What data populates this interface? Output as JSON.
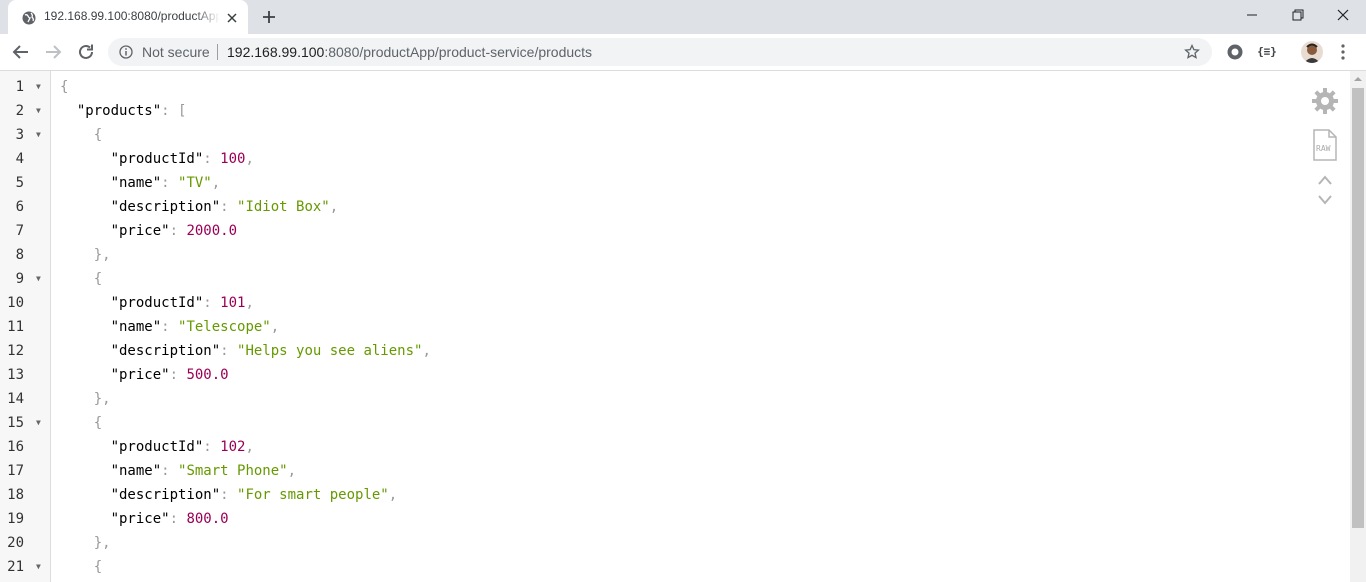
{
  "tab": {
    "title": "192.168.99.100:8080/productApp/product-service/products",
    "favicon": "globe-icon"
  },
  "toolbar": {
    "security_label": "Not secure",
    "url_host": "192.168.99.100",
    "url_rest": ":8080/productApp/product-service/products",
    "extension2_label": "{≡}"
  },
  "json_lines": [
    {
      "n": "1",
      "fold": true,
      "parts": [
        {
          "t": "{",
          "c": "pun"
        }
      ]
    },
    {
      "n": "2",
      "fold": true,
      "parts": [
        {
          "t": "  \"products\"",
          "c": ""
        },
        {
          "t": ": [",
          "c": "pun"
        }
      ]
    },
    {
      "n": "3",
      "fold": true,
      "parts": [
        {
          "t": "    {",
          "c": "pun"
        }
      ]
    },
    {
      "n": "4",
      "fold": false,
      "parts": [
        {
          "t": "      \"productId\"",
          "c": ""
        },
        {
          "t": ": ",
          "c": "pun"
        },
        {
          "t": "100",
          "c": "num"
        },
        {
          "t": ",",
          "c": "pun"
        }
      ]
    },
    {
      "n": "5",
      "fold": false,
      "parts": [
        {
          "t": "      \"name\"",
          "c": ""
        },
        {
          "t": ": ",
          "c": "pun"
        },
        {
          "t": "\"TV\"",
          "c": "str"
        },
        {
          "t": ",",
          "c": "pun"
        }
      ]
    },
    {
      "n": "6",
      "fold": false,
      "parts": [
        {
          "t": "      \"description\"",
          "c": ""
        },
        {
          "t": ": ",
          "c": "pun"
        },
        {
          "t": "\"Idiot Box\"",
          "c": "str"
        },
        {
          "t": ",",
          "c": "pun"
        }
      ]
    },
    {
      "n": "7",
      "fold": false,
      "parts": [
        {
          "t": "      \"price\"",
          "c": ""
        },
        {
          "t": ": ",
          "c": "pun"
        },
        {
          "t": "2000.0",
          "c": "num"
        }
      ]
    },
    {
      "n": "8",
      "fold": false,
      "parts": [
        {
          "t": "    },",
          "c": "pun"
        }
      ]
    },
    {
      "n": "9",
      "fold": true,
      "parts": [
        {
          "t": "    {",
          "c": "pun"
        }
      ]
    },
    {
      "n": "10",
      "fold": false,
      "parts": [
        {
          "t": "      \"productId\"",
          "c": ""
        },
        {
          "t": ": ",
          "c": "pun"
        },
        {
          "t": "101",
          "c": "num"
        },
        {
          "t": ",",
          "c": "pun"
        }
      ]
    },
    {
      "n": "11",
      "fold": false,
      "parts": [
        {
          "t": "      \"name\"",
          "c": ""
        },
        {
          "t": ": ",
          "c": "pun"
        },
        {
          "t": "\"Telescope\"",
          "c": "str"
        },
        {
          "t": ",",
          "c": "pun"
        }
      ]
    },
    {
      "n": "12",
      "fold": false,
      "parts": [
        {
          "t": "      \"description\"",
          "c": ""
        },
        {
          "t": ": ",
          "c": "pun"
        },
        {
          "t": "\"Helps you see aliens\"",
          "c": "str"
        },
        {
          "t": ",",
          "c": "pun"
        }
      ]
    },
    {
      "n": "13",
      "fold": false,
      "parts": [
        {
          "t": "      \"price\"",
          "c": ""
        },
        {
          "t": ": ",
          "c": "pun"
        },
        {
          "t": "500.0",
          "c": "num"
        }
      ]
    },
    {
      "n": "14",
      "fold": false,
      "parts": [
        {
          "t": "    },",
          "c": "pun"
        }
      ]
    },
    {
      "n": "15",
      "fold": true,
      "parts": [
        {
          "t": "    {",
          "c": "pun"
        }
      ]
    },
    {
      "n": "16",
      "fold": false,
      "parts": [
        {
          "t": "      \"productId\"",
          "c": ""
        },
        {
          "t": ": ",
          "c": "pun"
        },
        {
          "t": "102",
          "c": "num"
        },
        {
          "t": ",",
          "c": "pun"
        }
      ]
    },
    {
      "n": "17",
      "fold": false,
      "parts": [
        {
          "t": "      \"name\"",
          "c": ""
        },
        {
          "t": ": ",
          "c": "pun"
        },
        {
          "t": "\"Smart Phone\"",
          "c": "str"
        },
        {
          "t": ",",
          "c": "pun"
        }
      ]
    },
    {
      "n": "18",
      "fold": false,
      "parts": [
        {
          "t": "      \"description\"",
          "c": ""
        },
        {
          "t": ": ",
          "c": "pun"
        },
        {
          "t": "\"For smart people\"",
          "c": "str"
        },
        {
          "t": ",",
          "c": "pun"
        }
      ]
    },
    {
      "n": "19",
      "fold": false,
      "parts": [
        {
          "t": "      \"price\"",
          "c": ""
        },
        {
          "t": ": ",
          "c": "pun"
        },
        {
          "t": "800.0",
          "c": "num"
        }
      ]
    },
    {
      "n": "20",
      "fold": false,
      "parts": [
        {
          "t": "    },",
          "c": "pun"
        }
      ]
    },
    {
      "n": "21",
      "fold": true,
      "parts": [
        {
          "t": "    {",
          "c": "pun"
        }
      ]
    }
  ],
  "json_viewer": {
    "raw_label": "RAW"
  },
  "colors": {
    "number": "#990055",
    "string": "#669900",
    "punctuation": "#999999"
  }
}
